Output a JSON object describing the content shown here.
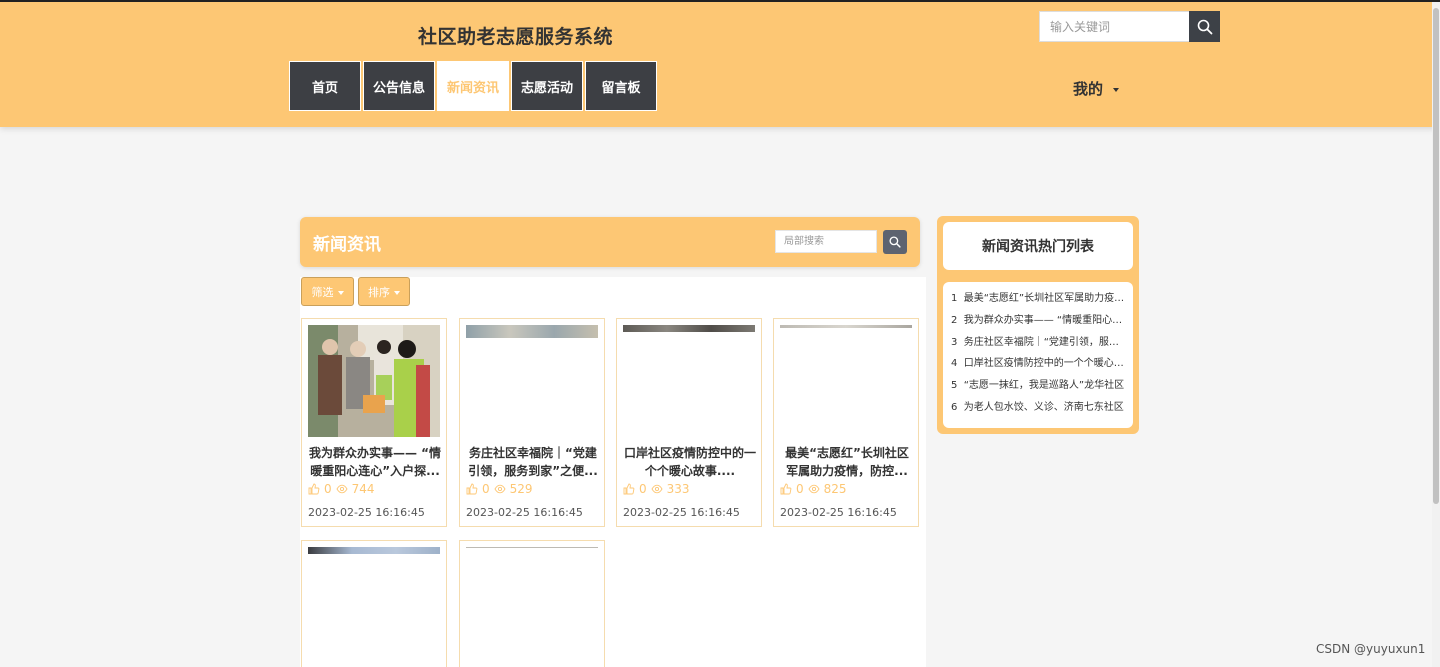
{
  "site": {
    "title": "社区助老志愿服务系统"
  },
  "top_search": {
    "placeholder": "输入关键词",
    "icon": "search-icon"
  },
  "nav": {
    "items": [
      {
        "label": "首页",
        "active": false
      },
      {
        "label": "公告信息",
        "active": false
      },
      {
        "label": "新闻资讯",
        "active": true
      },
      {
        "label": "志愿活动",
        "active": false
      },
      {
        "label": "留言板",
        "active": false
      }
    ],
    "my_label": "我的"
  },
  "news": {
    "title": "新闻资讯",
    "local_search_placeholder": "局部搜索",
    "filter_label": "筛选",
    "sort_label": "排序",
    "cards": [
      {
        "title": "我为群众办实事—— “情暖重阳心连心”入户探...",
        "likes": "0",
        "views": "744",
        "date": "2023-02-25 16:16:45"
      },
      {
        "title": "务庄社区幸福院｜“党建引领，服务到家”之便...",
        "likes": "0",
        "views": "529",
        "date": "2023-02-25 16:16:45"
      },
      {
        "title": "口岸社区疫情防控中的一个个暖心故事....",
        "likes": "0",
        "views": "333",
        "date": "2023-02-25 16:16:45"
      },
      {
        "title": "最美“志愿红”长圳社区军属助力疫情，防控...",
        "likes": "0",
        "views": "825",
        "date": "2023-02-25 16:16:45"
      }
    ]
  },
  "hot_list": {
    "title": "新闻资讯热门列表",
    "items": [
      {
        "rank": "1",
        "text": "最美“志愿红”长圳社区军属助力疫情防控"
      },
      {
        "rank": "2",
        "text": "我为群众办实事—— “情暖重阳心连心”入户探访"
      },
      {
        "rank": "3",
        "text": "务庄社区幸福院｜“党建引领，服务到家”"
      },
      {
        "rank": "4",
        "text": "口岸社区疫情防控中的一个个暖心故事"
      },
      {
        "rank": "5",
        "text": "“志愿一抹红，我是巡路人”龙华社区"
      },
      {
        "rank": "6",
        "text": "为老人包水饺、义诊、济南七东社区"
      }
    ]
  },
  "watermark": "CSDN @yuyuxun1",
  "colors": {
    "accent": "#fdc774",
    "nav_dark": "#3d3f44"
  }
}
